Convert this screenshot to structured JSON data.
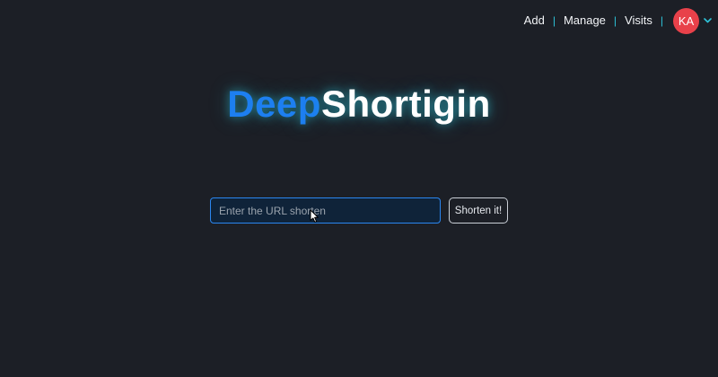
{
  "nav": {
    "links": [
      "Add",
      "Manage",
      "Visits"
    ],
    "separator": "|",
    "avatar_initials": "KA",
    "avatar_color": "#e8414a",
    "chevron_icon": "chevron-down-icon"
  },
  "logo": {
    "part1": "Deep",
    "part2": "Shortigin",
    "part1_color": "#1d7ff0",
    "glow_color": "#2ec4d9"
  },
  "form": {
    "url_placeholder": "Enter the URL shorten",
    "url_value": "",
    "submit_label": "Shorten it!"
  },
  "colors": {
    "background": "#1c1f26",
    "accent": "#2ec4d9",
    "input_border": "#2a86f0"
  }
}
